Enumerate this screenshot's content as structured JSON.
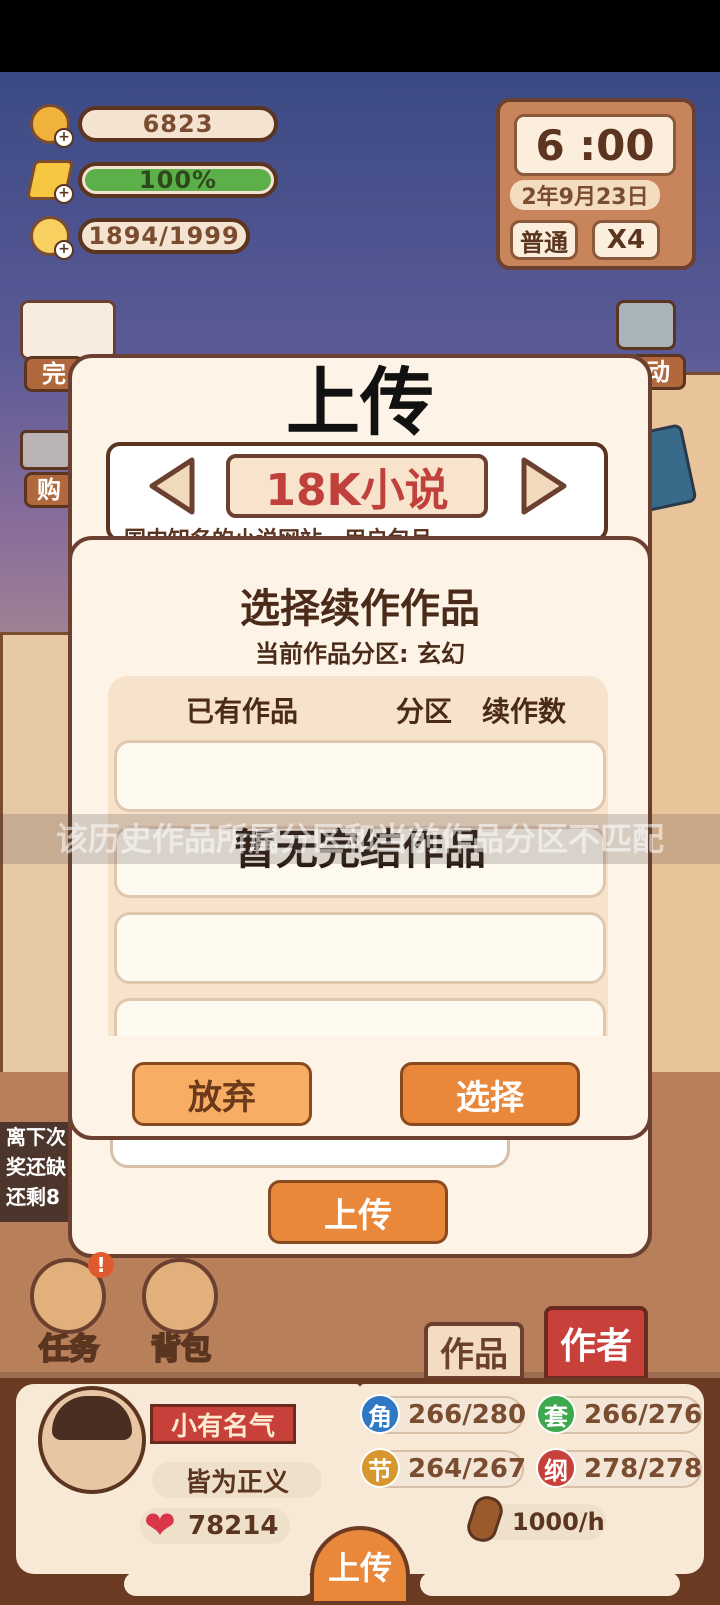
{
  "hud": {
    "gold": "6823",
    "energy": "100%",
    "energy_fraction": 1.0,
    "idea": "1894/1999"
  },
  "clock": {
    "time": "6 :00",
    "date": "2年9月23日",
    "mode": "普通",
    "speed": "X4"
  },
  "side": {
    "left_top": "完",
    "left_mid": "购",
    "right_top": "动"
  },
  "upload_dialog": {
    "title": "上传",
    "platform": "18K小说",
    "desc_partial": "国内知名的小说网站，用户包月",
    "upload_button": "上传"
  },
  "select_dialog": {
    "title": "选择续作作品",
    "subtitle": "当前作品分区: 玄幻",
    "col_works": "已有作品",
    "col_section": "分区",
    "col_count": "续作数",
    "empty_text": "暂无完结作品",
    "toast": "该历史作品所属分区和当前作品分区不匹配",
    "cancel_label": "放弃",
    "confirm_label": "选择"
  },
  "left_notice": {
    "line1": "离下次",
    "line2": "奖还缺",
    "line3": "还剩8"
  },
  "bottom_nav": {
    "task": "任务",
    "bag": "背包",
    "works_tab": "作品",
    "author_tab": "作者"
  },
  "profile": {
    "title_banner": "小有名气",
    "name": "皆为正义",
    "hearts": "78214",
    "stat_jiao": {
      "icon": "角",
      "value": "266/280"
    },
    "stat_tao": {
      "icon": "套",
      "value": "266/276"
    },
    "stat_jie": {
      "icon": "节",
      "value": "264/267"
    },
    "stat_gang": {
      "icon": "纲",
      "value": "278/278"
    },
    "rate": "1000/h",
    "bottom_upload": "上传"
  },
  "colors": {
    "panel_bg": "#fdf3e6",
    "border_brown": "#6b4030",
    "orange_btn": "#e9873a",
    "light_orange_btn": "#f7ad63",
    "title_red": "#c0413b",
    "energy_green": "#5cb04a"
  }
}
